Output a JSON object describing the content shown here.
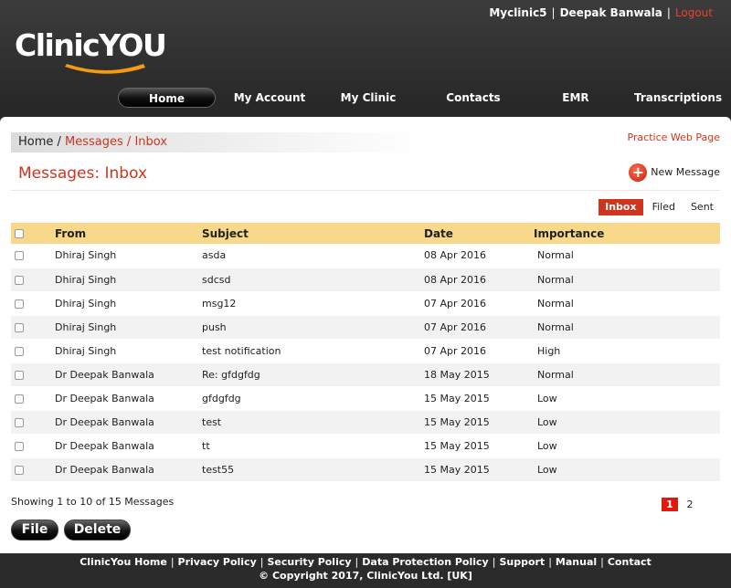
{
  "userbar": {
    "clinic": "Myclinic5",
    "user": "Deepak Banwala",
    "logout": "Logout"
  },
  "logo": {
    "text": "ClinicYOU"
  },
  "nav": [
    {
      "label": "Home",
      "active": true
    },
    {
      "label": "My Account"
    },
    {
      "label": "My Clinic"
    },
    {
      "label": "Contacts"
    },
    {
      "label": "EMR"
    },
    {
      "label": "Transcriptions"
    }
  ],
  "breadcrumb": {
    "home": "Home",
    "sep": " / ",
    "messages": "Messages",
    "inbox": "Inbox"
  },
  "practice_link": "Practice Web Page",
  "page_title": "Messages: Inbox",
  "new_message": "New Message",
  "tabs": [
    {
      "label": "Inbox",
      "active": true
    },
    {
      "label": "Filed"
    },
    {
      "label": "Sent"
    }
  ],
  "table": {
    "headers": [
      "From",
      "Subject",
      "Date",
      "Importance"
    ],
    "rows": [
      {
        "from": "Dhiraj Singh",
        "subject": "asda",
        "date": "08 Apr 2016",
        "importance": "Normal"
      },
      {
        "from": "Dhiraj Singh",
        "subject": "sdcsd",
        "date": "08 Apr 2016",
        "importance": "Normal"
      },
      {
        "from": "Dhiraj Singh",
        "subject": "msg12",
        "date": "07 Apr 2016",
        "importance": "Normal"
      },
      {
        "from": "Dhiraj Singh",
        "subject": "push",
        "date": "07 Apr 2016",
        "importance": "Normal"
      },
      {
        "from": "Dhiraj Singh",
        "subject": "test notification",
        "date": "07 Apr 2016",
        "importance": "High"
      },
      {
        "from": "Dr Deepak Banwala",
        "subject": "Re: gfdgfdg",
        "date": "18 May 2015",
        "importance": "Normal"
      },
      {
        "from": "Dr Deepak Banwala",
        "subject": "gfdgfdg",
        "date": "15 May 2015",
        "importance": "Low"
      },
      {
        "from": "Dr Deepak Banwala",
        "subject": "test",
        "date": "15 May 2015",
        "importance": "Low"
      },
      {
        "from": "Dr Deepak Banwala",
        "subject": "tt",
        "date": "15 May 2015",
        "importance": "Low"
      },
      {
        "from": "Dr Deepak Banwala",
        "subject": "test55",
        "date": "15 May 2015",
        "importance": "Low"
      }
    ]
  },
  "showing": "Showing 1 to 10 of 15 Messages",
  "pages": [
    "1",
    "2"
  ],
  "buttons": {
    "file": "File",
    "delete": "Delete"
  },
  "footer": {
    "links": [
      "ClinicYou Home",
      "Privacy Policy",
      "Security Policy",
      "Data Protection Policy",
      "Support",
      "Manual",
      "Contact"
    ],
    "copyright": "© Copyright 2017, ClinicYou Ltd. [UK]"
  },
  "colors": {
    "accent": "#d0341f",
    "header_row": "#f8d98b",
    "logo_swoosh": "#f39c12"
  }
}
